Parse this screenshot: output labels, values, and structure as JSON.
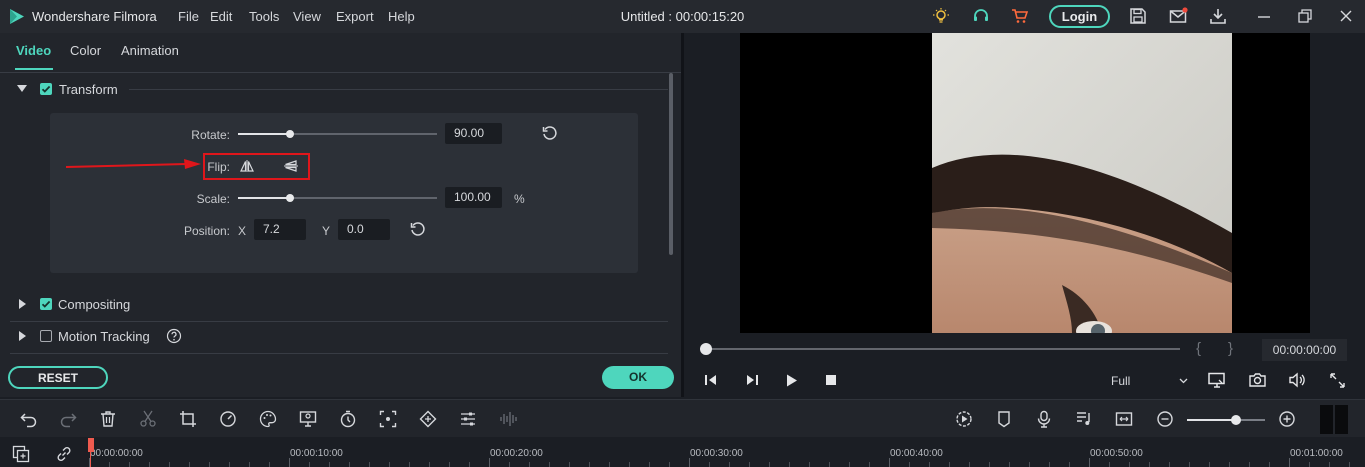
{
  "app": {
    "name": "Wondershare Filmora",
    "title": "Untitled : 00:00:15:20",
    "menu": [
      "File",
      "Edit",
      "Tools",
      "View",
      "Export",
      "Help"
    ],
    "login_label": "Login"
  },
  "left_panel": {
    "tabs": [
      "Video",
      "Color",
      "Animation"
    ],
    "active_tab": "Video",
    "transform": {
      "label": "Transform",
      "checked": true,
      "rotate_label": "Rotate:",
      "rotate_value": "90.00",
      "rotate_fraction": 0.26,
      "flip_label": "Flip:",
      "scale_label": "Scale:",
      "scale_value": "100.00",
      "scale_unit": "%",
      "scale_fraction": 0.26,
      "position_label": "Position:",
      "x_label": "X",
      "x_value": "7.2",
      "y_label": "Y",
      "y_value": "0.0"
    },
    "compositing": {
      "label": "Compositing",
      "checked": true
    },
    "motion_tracking": {
      "label": "Motion Tracking",
      "checked": false
    },
    "reset_label": "RESET",
    "ok_label": "OK"
  },
  "preview": {
    "timecode": "00:00:00:00",
    "zoom": "Full",
    "brace_open": "{",
    "brace_close": "}"
  },
  "timeline": {
    "ticks": [
      "00:00:00:00",
      "00:00:10:00",
      "00:00:20:00",
      "00:00:30:00",
      "00:00:40:00",
      "00:00:50:00",
      "00:01:00:00"
    ]
  },
  "colors": {
    "accent": "#4ed6bd",
    "highlight_box": "#e0161b",
    "playhead": "#ef5b4f"
  }
}
